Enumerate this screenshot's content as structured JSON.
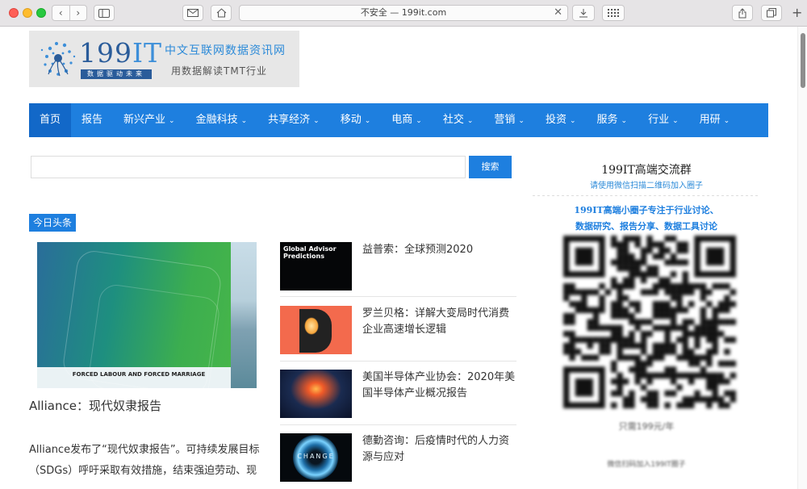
{
  "browser": {
    "url_display": "不安全 — 199it.com",
    "icons": [
      "back-icon",
      "forward-icon",
      "sidebar-icon",
      "mail-icon",
      "home-icon",
      "clear-icon",
      "download-icon",
      "grid-icon",
      "share-icon",
      "tabs-icon",
      "new-tab-icon"
    ]
  },
  "logo": {
    "brand_num": "199",
    "brand_it": "IT",
    "tagline_small": "数据驱动未来",
    "title": "中文互联网数据资讯网",
    "subtitle": "用数据解读TMT行业"
  },
  "nav": {
    "items": [
      {
        "label": "首页",
        "dropdown": false
      },
      {
        "label": "报告",
        "dropdown": false
      },
      {
        "label": "新兴产业",
        "dropdown": true
      },
      {
        "label": "金融科技",
        "dropdown": true
      },
      {
        "label": "共享经济",
        "dropdown": true
      },
      {
        "label": "移动",
        "dropdown": true
      },
      {
        "label": "电商",
        "dropdown": true
      },
      {
        "label": "社交",
        "dropdown": true
      },
      {
        "label": "营销",
        "dropdown": true
      },
      {
        "label": "投资",
        "dropdown": true
      },
      {
        "label": "服务",
        "dropdown": true
      },
      {
        "label": "行业",
        "dropdown": true
      },
      {
        "label": "用研",
        "dropdown": true
      }
    ]
  },
  "search": {
    "value": "",
    "button_label": "搜索"
  },
  "today_label": "今日头条",
  "featured": {
    "image_caption": "FORCED LABOUR AND FORCED MARRIAGE",
    "title": "Alliance：现代奴隶报告",
    "description": "Alliance发布了“现代奴隶报告”。可持续发展目标（SDGs）呼吁采取有效措施，结束强迫劳动、现"
  },
  "articles": [
    {
      "title": "益普索：全球预测2020",
      "thumb_text": "Global Advisor Predictions"
    },
    {
      "title": "罗兰贝格：详解大变局时代消费企业高速增长逻辑",
      "thumb_text": ""
    },
    {
      "title": "美国半导体产业协会：2020年美国半导体产业概况报告",
      "thumb_text": ""
    },
    {
      "title": "德勤咨询：后疫情时代的人力资源与应对",
      "thumb_text": "CHANGE"
    }
  ],
  "sidebar": {
    "title": "199IT高端交流群",
    "subtitle": "请使用微信扫描二维码加入圈子",
    "intro_line1": "199IT高端小圈子专注于行业讨论、",
    "intro_line2": "数据研究、报告分享、数据工具讨论",
    "qr_caption": "只需199元/年",
    "qr_footer": "微信扫码加入199IT圈子"
  },
  "colors": {
    "nav_blue": "#1e7fdf",
    "nav_active": "#1268c8",
    "logo_bg": "#e7e7e7"
  }
}
